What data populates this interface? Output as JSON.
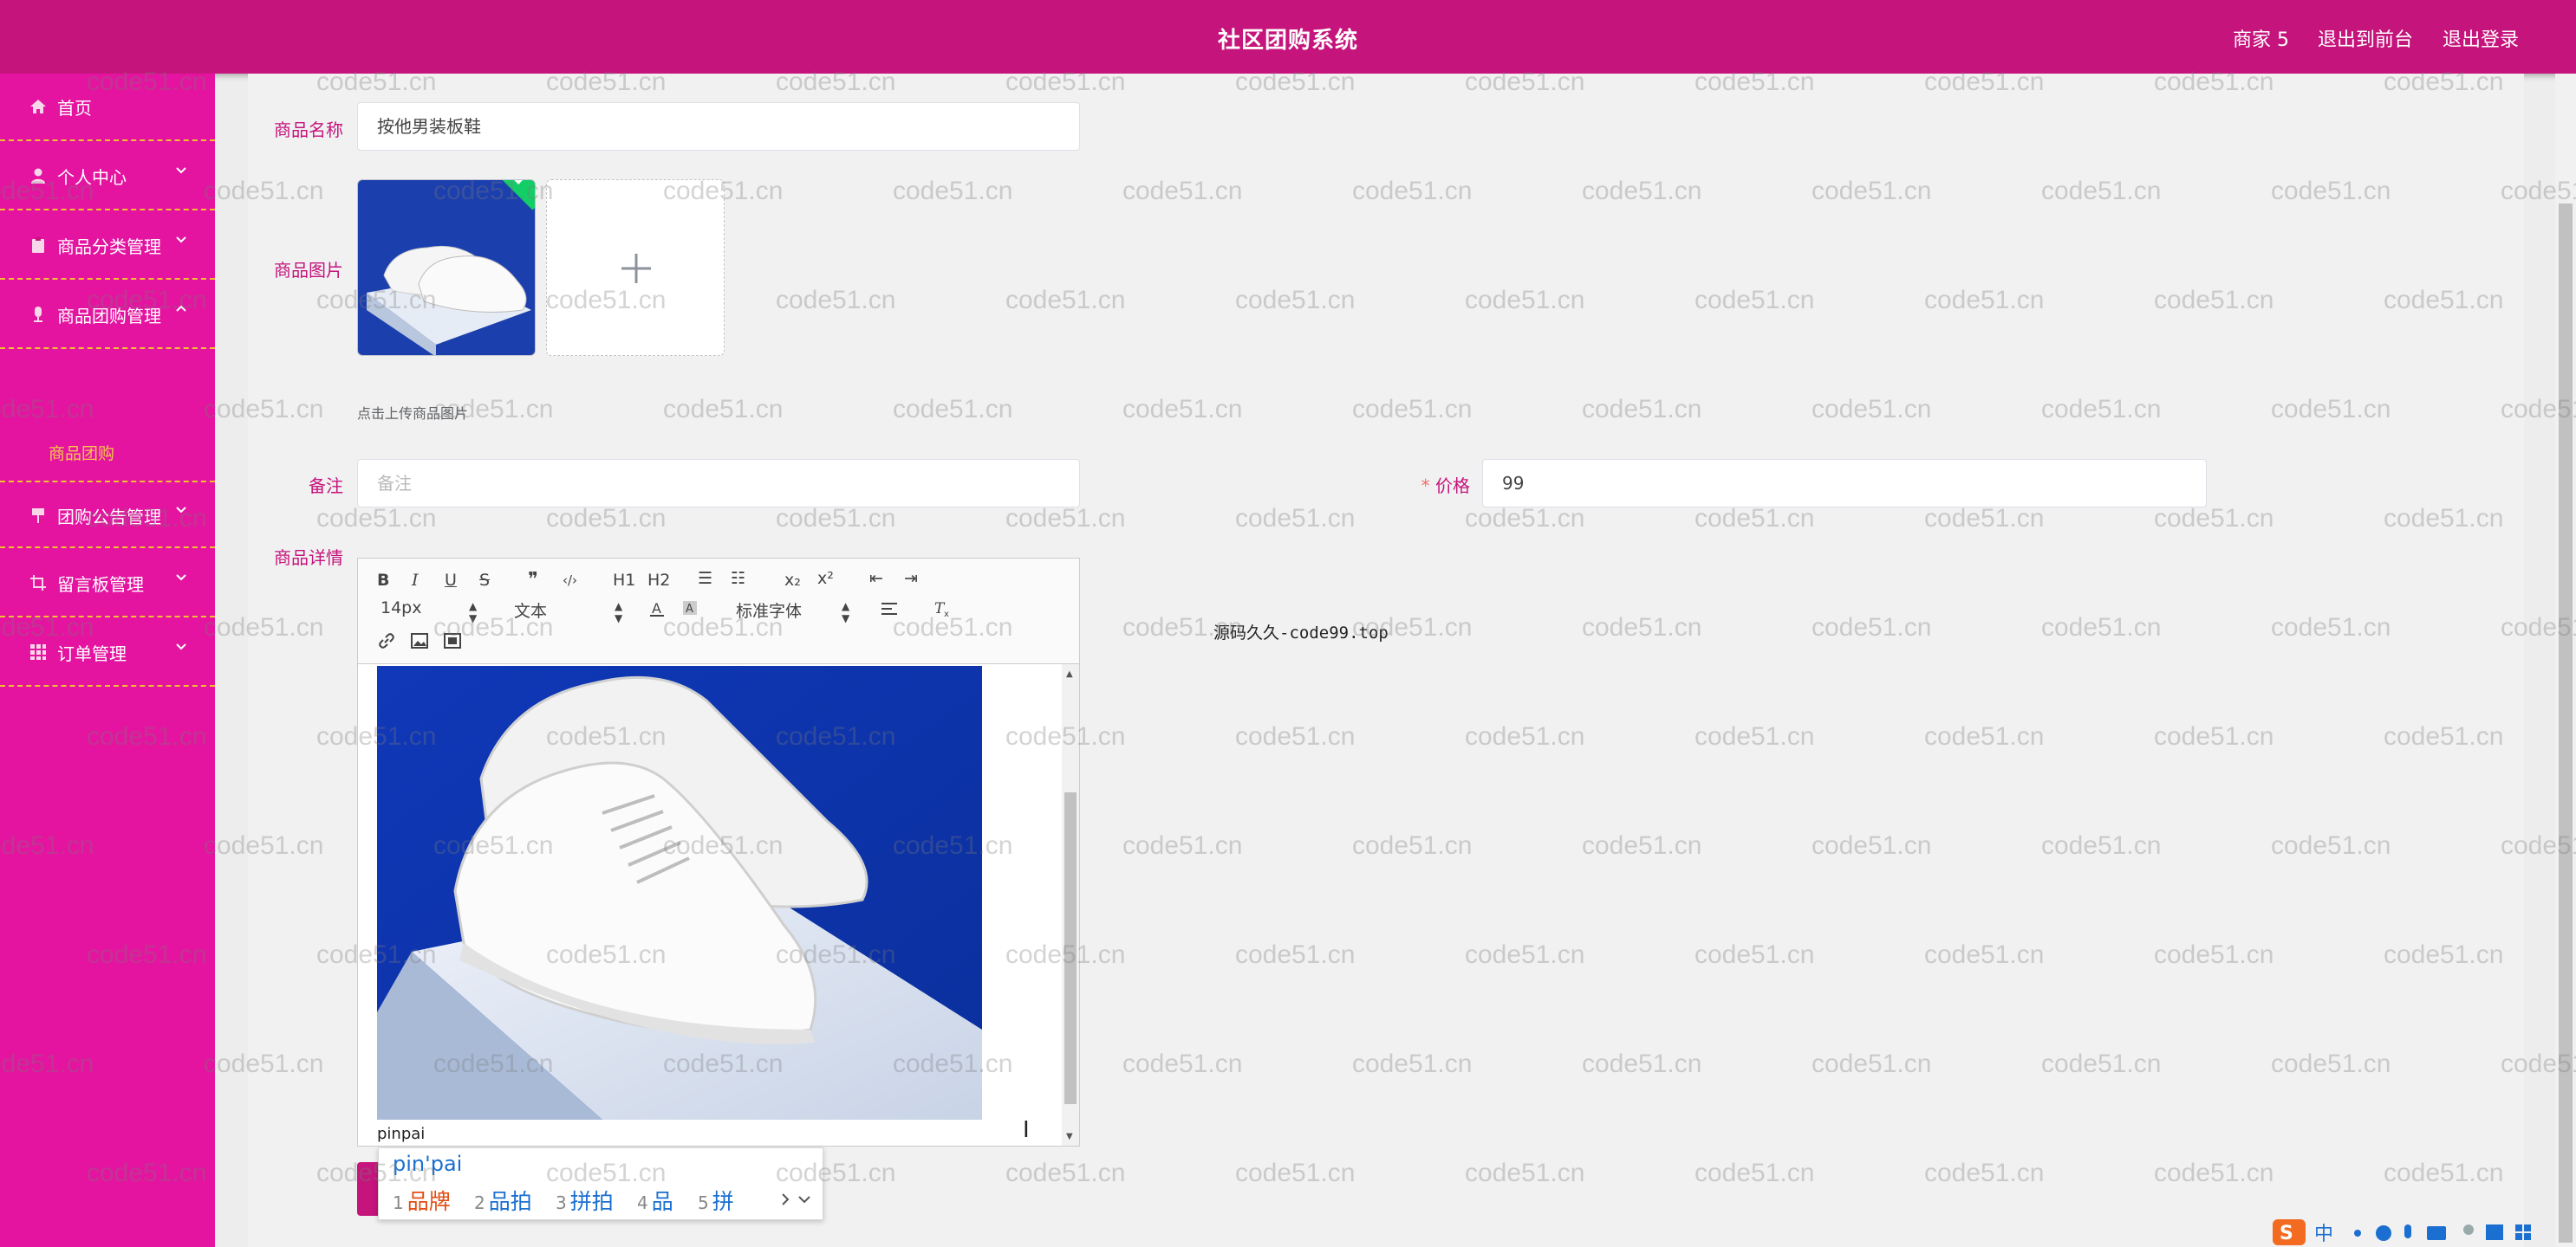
{
  "header": {
    "title": "社区团购系统",
    "user": "商家 5",
    "front_link": "退出到前台",
    "logout_link": "退出登录"
  },
  "sidebar": {
    "items": [
      {
        "label": "首页",
        "icon": "home-icon"
      },
      {
        "label": "个人中心",
        "icon": "user-icon"
      },
      {
        "label": "商品分类管理",
        "icon": "clipboard-icon"
      },
      {
        "label": "商品团购管理",
        "icon": "mic-icon",
        "expanded": true
      },
      {
        "label": "团购公告管理",
        "icon": "flag-icon"
      },
      {
        "label": "留言板管理",
        "icon": "crop-icon"
      },
      {
        "label": "订单管理",
        "icon": "grid-icon"
      }
    ],
    "active_subitem": "商品团购"
  },
  "form": {
    "name_label": "商品名称",
    "name_value": "按他男装板鞋",
    "image_label": "商品图片",
    "upload_tip": "点击上传商品图片",
    "remark_label": "备注",
    "remark_placeholder": "备注",
    "price_required_mark": "*",
    "price_label": "价格",
    "price_value": "99",
    "detail_label": "商品详情"
  },
  "editor": {
    "toolbar_row1": [
      "B",
      "I",
      "U",
      "S",
      "❞",
      "‹/›",
      "H1",
      "H2",
      "☰",
      "☷",
      "x₂",
      "x²",
      "⇤",
      "⇥"
    ],
    "font_size": "14px",
    "text_style": "文本",
    "font_family": "标准字体",
    "content_text": "pinpai"
  },
  "ime": {
    "pinyin": "pin'pai",
    "candidates": [
      {
        "num": "1",
        "text": "品牌"
      },
      {
        "num": "2",
        "text": "品拍"
      },
      {
        "num": "3",
        "text": "拼拍"
      },
      {
        "num": "4",
        "text": "品"
      },
      {
        "num": "5",
        "text": "拼"
      }
    ]
  },
  "overlay_text": "源码久久-code99.top",
  "watermark": "code51.cn",
  "colors": {
    "header": "#c5147c",
    "sidebar": "#e414a0",
    "sidebar_divider": "#f2c033",
    "active_subitem": "#f4c64a",
    "label": "#c5147c"
  }
}
